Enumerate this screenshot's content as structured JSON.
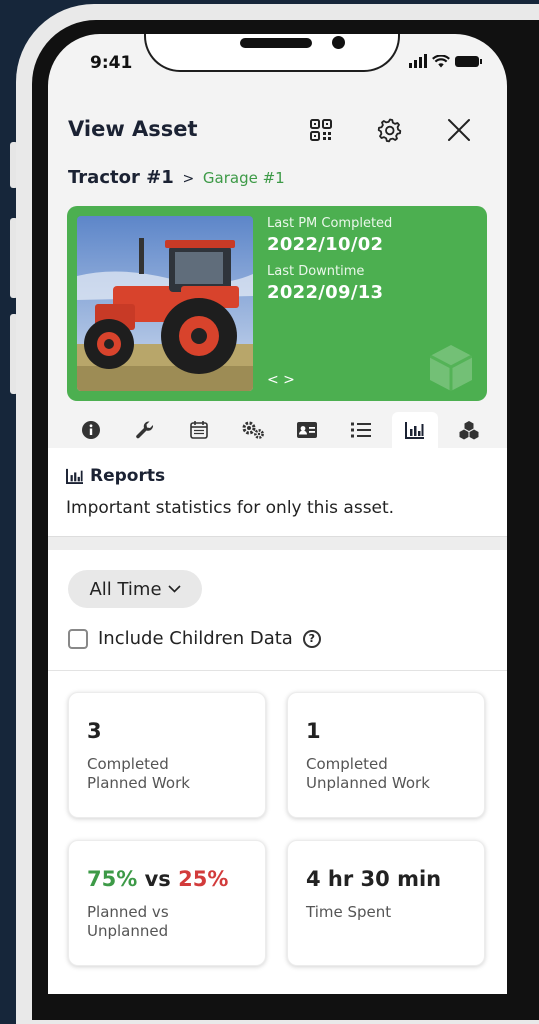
{
  "status_bar": {
    "time": "9:41"
  },
  "header": {
    "title": "View Asset"
  },
  "breadcrumb": {
    "asset": "Tractor #1",
    "separator": ">",
    "location": "Garage #1"
  },
  "hero": {
    "last_pm_label": "Last PM Completed",
    "last_pm_value": "2022/10/02",
    "last_downtime_label": "Last Downtime",
    "last_downtime_value": "2022/09/13",
    "carousel": "< >"
  },
  "tabs": [
    {
      "icon": "info-icon"
    },
    {
      "icon": "wrench-icon"
    },
    {
      "icon": "calendar-icon"
    },
    {
      "icon": "gears-icon"
    },
    {
      "icon": "id-card-icon"
    },
    {
      "icon": "list-icon"
    },
    {
      "icon": "chart-icon",
      "active": true
    },
    {
      "icon": "cubes-icon"
    }
  ],
  "reports": {
    "title": "Reports",
    "description": "Important statistics for only this asset."
  },
  "filter": {
    "selected": "All Time"
  },
  "include_children": {
    "label": "Include Children Data",
    "checked": false
  },
  "cards": {
    "planned": {
      "value": "3",
      "label": "Completed\nPlanned Work"
    },
    "unplanned": {
      "value": "1",
      "label": "Completed\nUnplanned Work"
    },
    "ratio": {
      "planned": "75%",
      "vs": "vs",
      "unplanned": "25%",
      "label": "Planned vs\nUnplanned"
    },
    "time": {
      "value": "4 hr 30 min",
      "label": "Time Spent"
    }
  },
  "colors": {
    "accent_green": "#4caf50",
    "text_green": "#3d9a47",
    "text_red": "#d23b3b",
    "background": "#16263a"
  }
}
